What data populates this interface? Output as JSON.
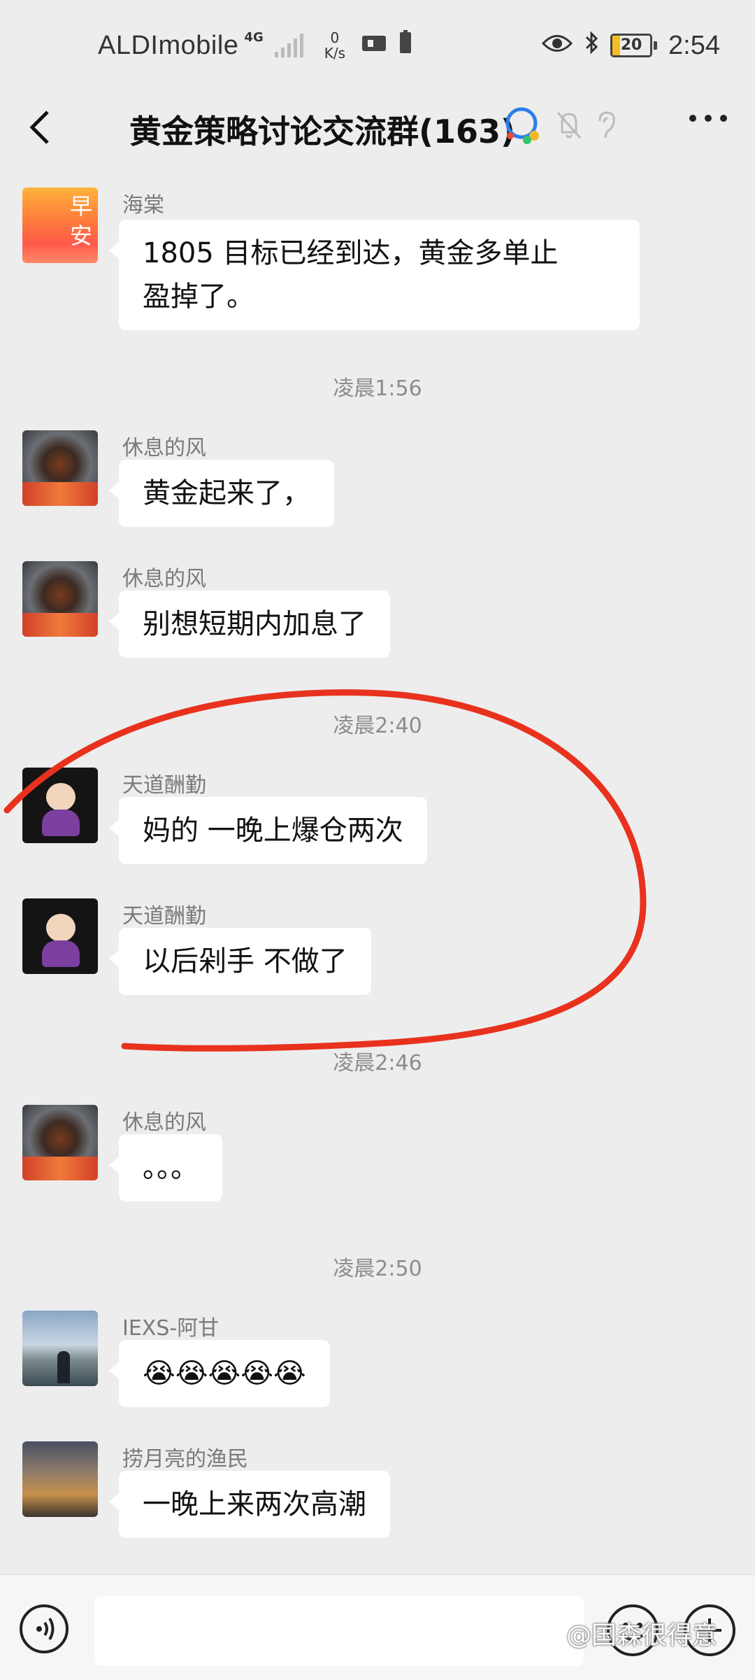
{
  "status_bar": {
    "carrier": "ALDImobile",
    "network": "4G",
    "speed_value": "0",
    "speed_unit": "K/s",
    "battery": "20",
    "battery_level_percent": 20,
    "time": "2:54",
    "icons": [
      "signal-bars-icon",
      "card-icon",
      "sim-battery-icon",
      "eye-icon",
      "bluetooth-icon",
      "battery-icon"
    ]
  },
  "header": {
    "back_icon": "chevron-left-icon",
    "title": "黄金策略讨论交流群(163)",
    "icons": [
      "enterprise-chat-icon",
      "mute-bell-icon",
      "ear-icon",
      "more-icon"
    ]
  },
  "messages": [
    {
      "sender": "海棠",
      "text_line1": "1805 目标已经到达，黄金多单止",
      "text_line2": "盈掉了。",
      "avatar_text_top": "早",
      "avatar_text_bottom": "安"
    },
    {
      "time": "凌晨1:56"
    },
    {
      "sender": "休息的风",
      "text": "黄金起来了，"
    },
    {
      "sender": "休息的风",
      "text": "别想短期内加息了"
    },
    {
      "time": "凌晨2:40"
    },
    {
      "sender": "天道酬勤",
      "text": "妈的 一晚上爆仓两次"
    },
    {
      "sender": "天道酬勤",
      "text": "以后剁手 不做了"
    },
    {
      "time": "凌晨2:46"
    },
    {
      "sender": "休息的风",
      "text": "。。。"
    },
    {
      "time": "凌晨2:50"
    },
    {
      "sender": "IEXS-阿甘",
      "text": "😭😭😭😭😭"
    },
    {
      "sender": "捞月亮的渔民",
      "text": "一晚上来两次高潮"
    }
  ],
  "input_bar": {
    "voice_icon": "voice-icon",
    "emoji_icon": "emoji-icon",
    "plus_icon": "plus-icon"
  },
  "watermark": "@国森很得意",
  "colors": {
    "background": "#ededed",
    "bubble": "#ffffff",
    "annotation": "#e8321e"
  }
}
